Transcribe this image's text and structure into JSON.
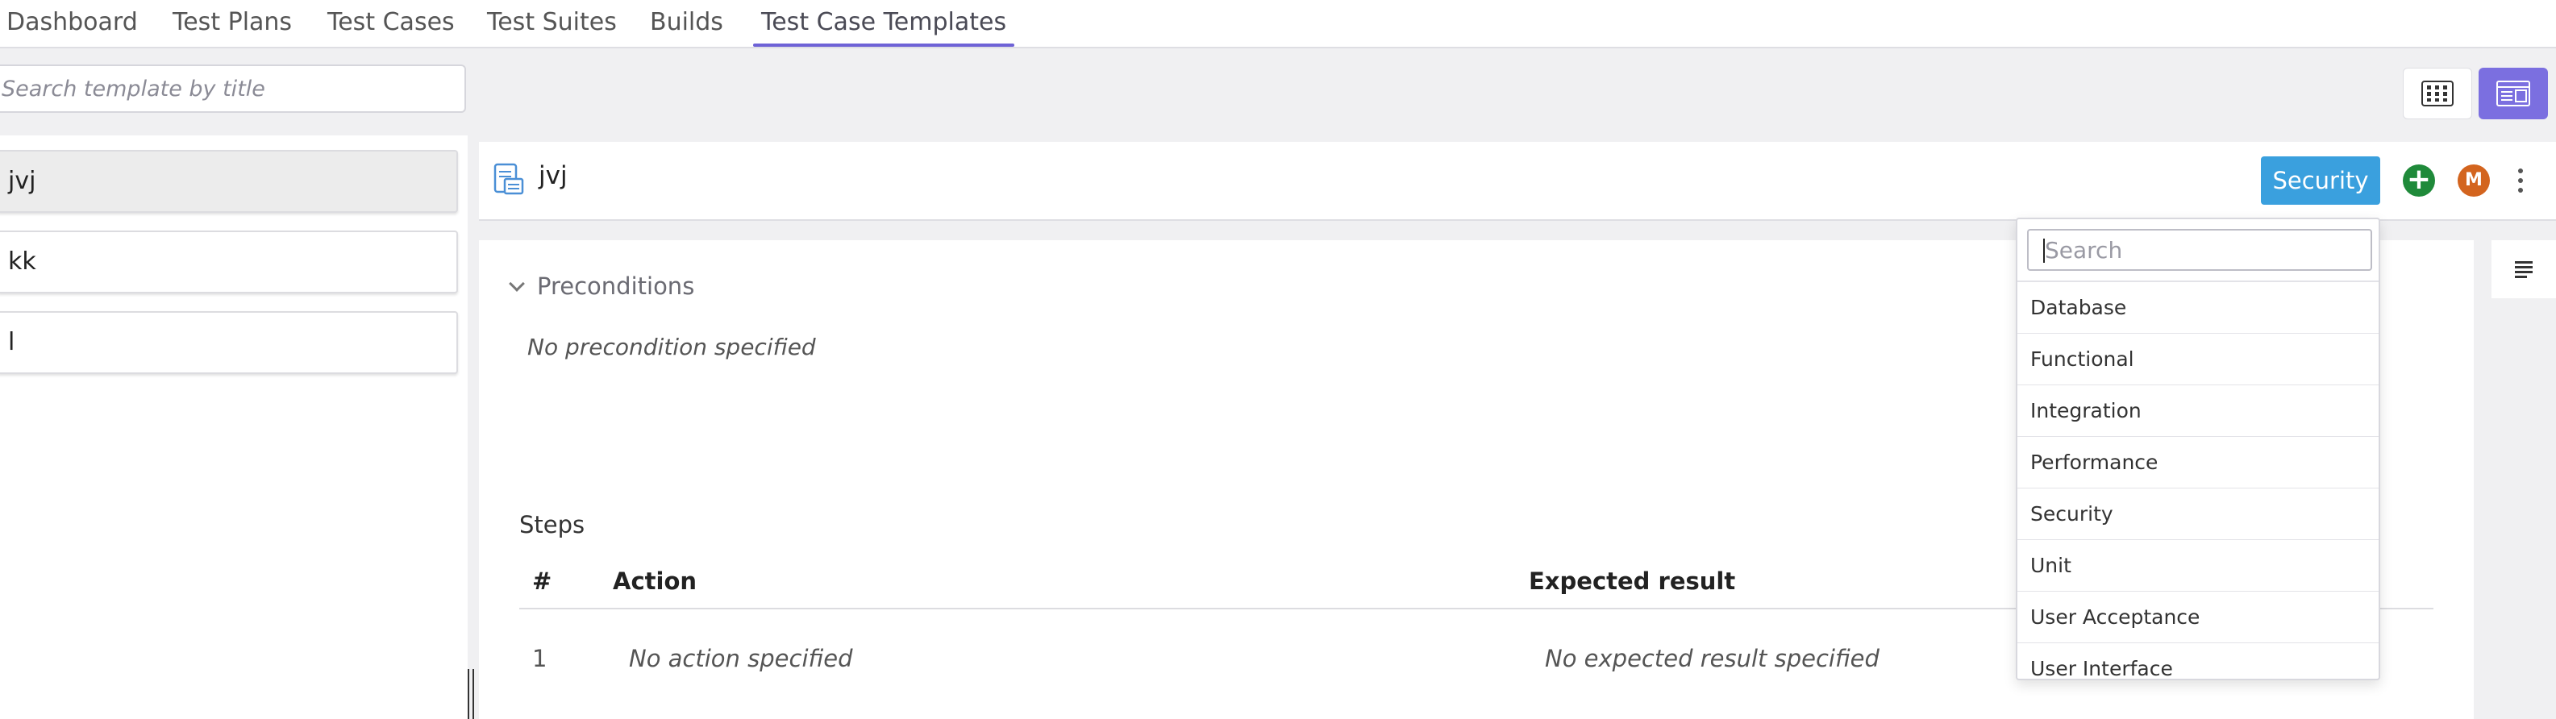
{
  "nav": {
    "tabs": [
      {
        "label": "Dashboard"
      },
      {
        "label": "Test Plans"
      },
      {
        "label": "Test Cases"
      },
      {
        "label": "Test Suites"
      },
      {
        "label": "Builds"
      },
      {
        "label": "Test Case Templates"
      }
    ],
    "active": "Test Case Templates"
  },
  "search": {
    "placeholder": "Search template by title"
  },
  "templates": [
    {
      "title": "jvj"
    },
    {
      "title": "kk"
    },
    {
      "title": "l"
    }
  ],
  "detail": {
    "title": "jvj",
    "type_button": "Security",
    "avatar_initial": "M"
  },
  "preconditions": {
    "heading": "Preconditions",
    "empty_text": "No precondition specified"
  },
  "steps": {
    "label": "Steps",
    "columns": [
      "#",
      "Action",
      "Expected result"
    ],
    "rows": [
      {
        "num": "1",
        "action": "No action specified",
        "expected": "No expected result specified"
      }
    ]
  },
  "dropdown": {
    "search_placeholder": "Search",
    "options": [
      "Database",
      "Functional",
      "Integration",
      "Performance",
      "Security",
      "Unit",
      "User Acceptance",
      "User Interface"
    ]
  },
  "colors": {
    "accent": "#6e62d6",
    "type_button": "#3aa0de",
    "add_button": "#1f8a3a",
    "avatar": "#d3641e"
  }
}
